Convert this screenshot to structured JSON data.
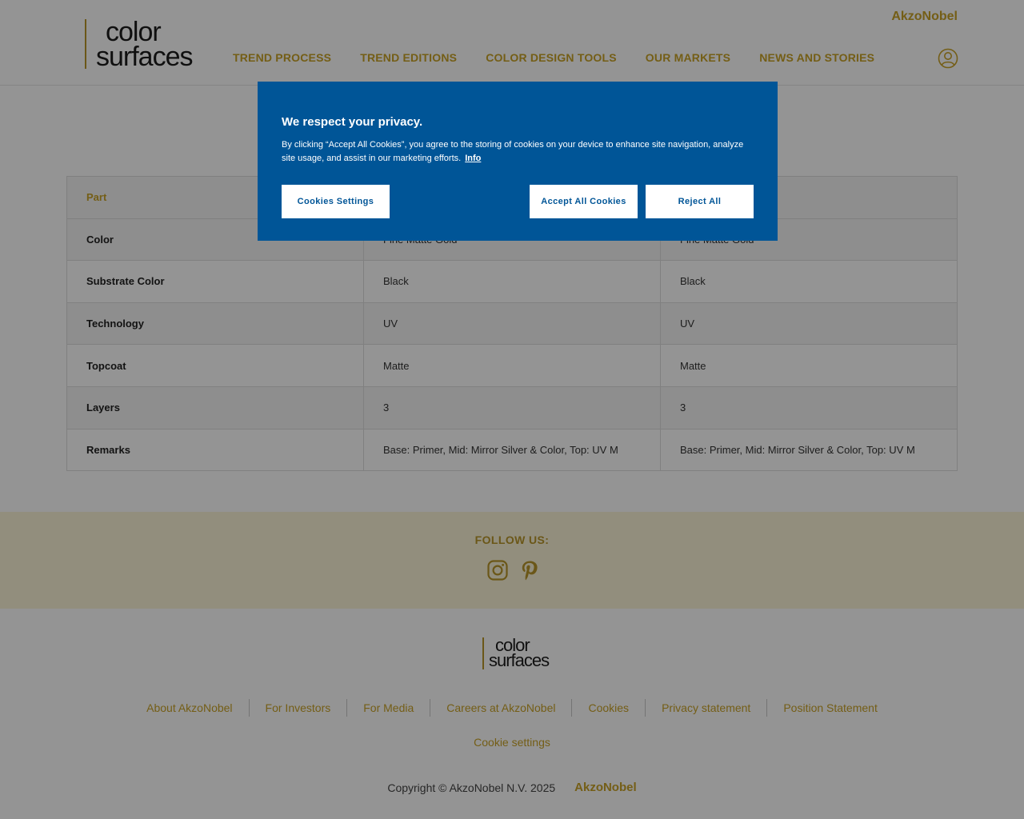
{
  "header": {
    "logo": {
      "line1": "color",
      "line2": "surfaces"
    },
    "brand": "AkzoNobel",
    "nav": [
      "TREND PROCESS",
      "TREND EDITIONS",
      "COLOR DESIGN TOOLS",
      "OUR MARKETS",
      "NEWS AND STORIES"
    ],
    "account_icon": "user-circle-icon"
  },
  "table": {
    "header": [
      "Part",
      "",
      ""
    ],
    "rows": [
      {
        "label": "Color",
        "values": [
          "Fine Matte Gold",
          "Fine Matte Gold"
        ]
      },
      {
        "label": "Substrate Color",
        "values": [
          "Black",
          "Black"
        ]
      },
      {
        "label": "Technology",
        "values": [
          "UV",
          "UV"
        ]
      },
      {
        "label": "Topcoat",
        "values": [
          "Matte",
          "Matte"
        ]
      },
      {
        "label": "Layers",
        "values": [
          "3",
          "3"
        ]
      },
      {
        "label": "Remarks",
        "values": [
          "Base: Primer, Mid: Mirror Silver & Color, Top: UV M",
          "Base: Primer, Mid: Mirror Silver & Color, Top: UV M"
        ]
      }
    ]
  },
  "follow": {
    "title": "FOLLOW US:",
    "icons": [
      "instagram-icon",
      "pinterest-icon"
    ]
  },
  "footer": {
    "logo": {
      "line1": "color",
      "line2": "surfaces"
    },
    "links": [
      "About AkzoNobel",
      "For Investors",
      "For Media",
      "Careers at AkzoNobel",
      "Cookies",
      "Privacy statement",
      "Position Statement"
    ],
    "cookie_settings": "Cookie settings",
    "copyright": "Copyright © AkzoNobel N.V. 2025",
    "brand": "AkzoNobel"
  },
  "cookie_banner": {
    "title": "We respect your privacy.",
    "text": "By clicking “Accept All Cookies”, you agree to the storing of cookies on your device to enhance site navigation, analyze site usage, and assist in our marketing efforts.",
    "info_link": "Info",
    "settings_button": "Cookies Settings",
    "accept_button": "Accept All Cookies",
    "reject_button": "Reject All"
  },
  "colors": {
    "accent_gold": "#c9a227",
    "banner_blue": "#005597",
    "follow_band": "#fbf4d8"
  }
}
